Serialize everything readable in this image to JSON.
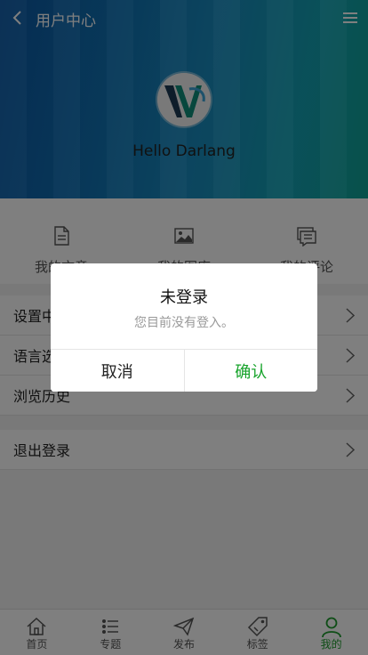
{
  "header": {
    "title": "用户中心",
    "username": "Hello Darlang"
  },
  "tabs": [
    {
      "label": "我的文章",
      "icon": "document-icon"
    },
    {
      "label": "我的图库",
      "icon": "image-icon"
    },
    {
      "label": "我的评论",
      "icon": "comment-icon"
    }
  ],
  "menu": {
    "settings": "设置中心",
    "language": "语言选择",
    "history": "浏览历史",
    "logout": "退出登录"
  },
  "dialog": {
    "title": "未登录",
    "message": "您目前没有登入。",
    "cancel": "取消",
    "confirm": "确认"
  },
  "bottom_nav": [
    {
      "label": "首页",
      "icon": "home-icon"
    },
    {
      "label": "专题",
      "icon": "list-icon"
    },
    {
      "label": "发布",
      "icon": "send-icon"
    },
    {
      "label": "标签",
      "icon": "tag-icon"
    },
    {
      "label": "我的",
      "icon": "user-icon",
      "active": true
    }
  ],
  "colors": {
    "accent_green": "#16a32a",
    "header_blue": "#1075b8"
  }
}
